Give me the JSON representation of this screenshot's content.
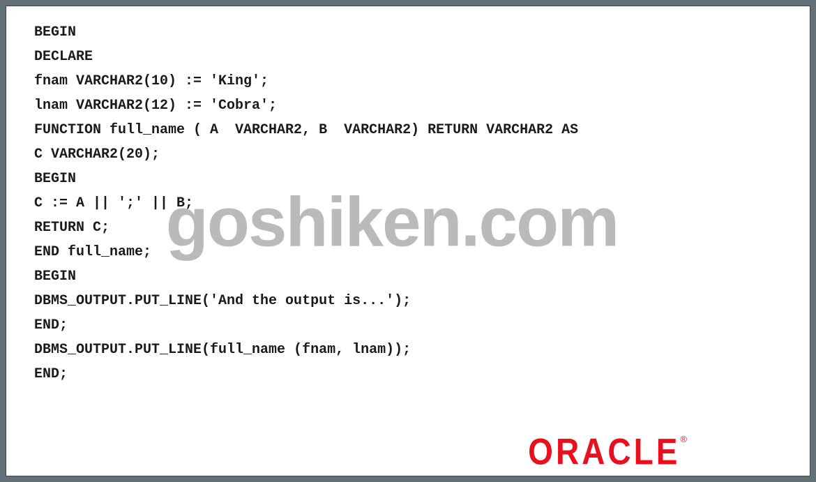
{
  "code": {
    "line1": "BEGIN",
    "line2": "DECLARE",
    "line3": "fnam VARCHAR2(10) := 'King';",
    "line4": "lnam VARCHAR2(12) := 'Cobra';",
    "line5": "FUNCTION full_name ( A  VARCHAR2, B  VARCHAR2) RETURN VARCHAR2 AS",
    "line6": "C VARCHAR2(20);",
    "line7": "BEGIN",
    "line8": "C := A || ';' || B;",
    "line9": "RETURN C;",
    "line10": "END full_name;",
    "line11": "BEGIN",
    "line12": "DBMS_OUTPUT.PUT_LINE('And the output is...');",
    "line13": "END;",
    "line14": "DBMS_OUTPUT.PUT_LINE(full_name (fnam, lnam));",
    "line15": "END;"
  },
  "watermark": "goshiken.com",
  "logo": {
    "text": "ORACLE",
    "reg": "®"
  }
}
